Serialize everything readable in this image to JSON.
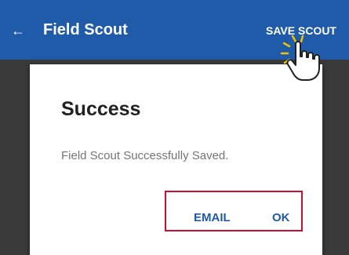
{
  "app_bar": {
    "back_icon": "arrow-back-icon",
    "title": "Field Scout",
    "action_label": "SAVE SCOUT",
    "color": "#1f5ba8"
  },
  "dialog": {
    "title": "Success",
    "message": "Field Scout Successfully Saved.",
    "actions": {
      "email_label": "EMAIL",
      "ok_label": "OK"
    },
    "highlight_color": "#c8102e"
  },
  "cursor": {
    "icon": "hand-pointer-click-icon"
  }
}
